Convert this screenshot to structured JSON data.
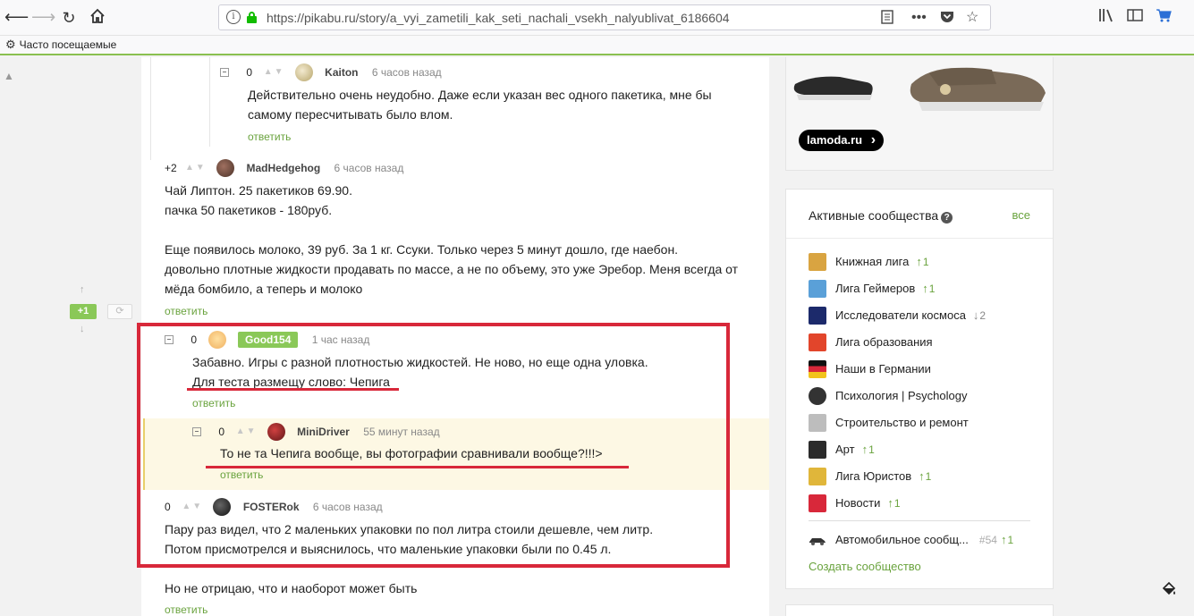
{
  "browser": {
    "url": "https://pikabu.ru/story/a_vyi_zametili_kak_seti_nachali_vsekh_nalyublivat_6186604",
    "bookmark_label": "Часто посещаемые"
  },
  "widget": {
    "rating": "+1"
  },
  "comments": [
    {
      "rating": "0",
      "author": "Kaiton",
      "time": "6 часов назад",
      "lines": [
        "Действительно очень неудобно. Даже если указан вес одного пакетика, мне бы",
        "самому пересчитывать было влом."
      ],
      "reply": "ответить"
    },
    {
      "rating": "+2",
      "author": "MadHedgehog",
      "time": "6 часов назад",
      "lines": [
        "Чай Липтон. 25 пакетиков 69.90.",
        "пачка 50 пакетиков - 180руб.",
        "",
        "Еще появилось молоко, 39 руб. За 1 кг. Ссуки. Только через 5 минут дошло, где наебон.",
        "довольно плотные жидкости продавать по массе, а не по объему, это уже Эребор. Меня всегда от",
        "мёда бомбило, а теперь и молоко"
      ],
      "reply": "ответить"
    },
    {
      "rating": "0",
      "author": "Good154",
      "time": "1 час назад",
      "lines": [
        "Забавно. Игры с разной плотностью жидкостей. Не ново, но еще одна уловка.",
        "Для теста размещу слово: Чепига"
      ],
      "reply": "ответить"
    },
    {
      "rating": "0",
      "author": "MiniDriver",
      "time": "55 минут назад",
      "lines": [
        "То не та Чепига вообще, вы фотографии сравнивали вообще?!!!>"
      ],
      "reply": "ответить"
    },
    {
      "rating": "0",
      "author": "FOSTERok",
      "time": "6 часов назад",
      "lines": [
        "Пару раз видел, что 2 маленьких упаковки по пол литра стоили дешевле, чем литр.",
        "Потом присмотрелся и выяснилось, что маленькие упаковки были по 0.45 л."
      ],
      "reply": ""
    },
    {
      "lines": [
        "Но не отрицаю, что и наоборот может быть"
      ],
      "reply": "ответить"
    }
  ],
  "ad": {
    "badge": "lamoda.ru"
  },
  "communities": {
    "title": "Активные сообщества",
    "all_link": "все",
    "items": [
      {
        "name": "Книжная лига",
        "trend": "1",
        "dir": "up",
        "icon_color": "#d9a441"
      },
      {
        "name": "Лига Геймеров",
        "trend": "1",
        "dir": "up",
        "icon_color": "#5aa0d8"
      },
      {
        "name": "Исследователи космоса",
        "trend": "2",
        "dir": "down",
        "icon_color": "#1c2a6b"
      },
      {
        "name": "Лига образования",
        "trend": "",
        "dir": "",
        "icon_color": "#e2452b"
      },
      {
        "name": "Наши в Германии",
        "trend": "",
        "dir": "",
        "icon_color": "#e8b21c"
      },
      {
        "name": "Психология | Psychology",
        "trend": "",
        "dir": "",
        "icon_color": "#333333"
      },
      {
        "name": "Строительство и ремонт",
        "trend": "",
        "dir": "",
        "icon_color": "#9a9a9a"
      },
      {
        "name": "Арт",
        "trend": "1",
        "dir": "up",
        "icon_color": "#2b2b2b"
      },
      {
        "name": "Лига Юристов",
        "trend": "1",
        "dir": "up",
        "icon_color": "#e0b63a"
      },
      {
        "name": "Новости",
        "trend": "1",
        "dir": "up",
        "icon_color": "#d8283a"
      }
    ],
    "extra": {
      "name": "Автомобильное сообщ...",
      "num": "#54",
      "trend": "1"
    },
    "create": "Создать сообщество"
  }
}
